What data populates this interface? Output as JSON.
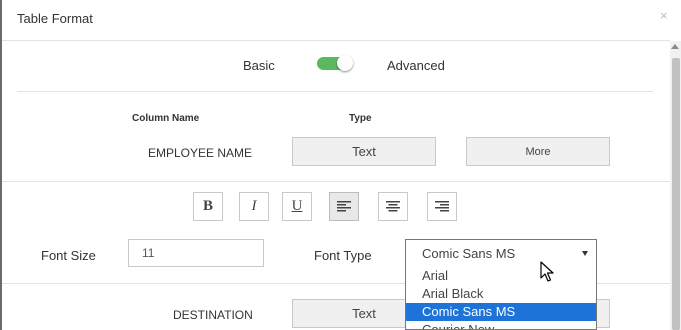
{
  "dialog": {
    "title": "Table Format",
    "close_glyph": "×"
  },
  "mode": {
    "basic_label": "Basic",
    "advanced_label": "Advanced",
    "toggle_on": true,
    "toggle_color": "#5cb85c"
  },
  "columns": {
    "name_header": "Column Name",
    "type_header": "Type"
  },
  "row1": {
    "name": "EMPLOYEE NAME",
    "type_button": "Text",
    "more_button": "More"
  },
  "format_buttons": {
    "bold": "B",
    "italic": "I",
    "underline": "U",
    "active": "align-left"
  },
  "font": {
    "size_label": "Font Size",
    "size_value": "11",
    "type_label": "Font Type",
    "type_value": "Comic Sans MS",
    "options": [
      "Arial",
      "Arial Black",
      "Comic Sans MS",
      "Courier New"
    ],
    "selected_option": "Comic Sans MS"
  },
  "row2": {
    "name": "DESTINATION",
    "type_button": "Text"
  },
  "colors": {
    "selected_bg": "#1e73d8",
    "button_bg": "#f0f0f0"
  }
}
